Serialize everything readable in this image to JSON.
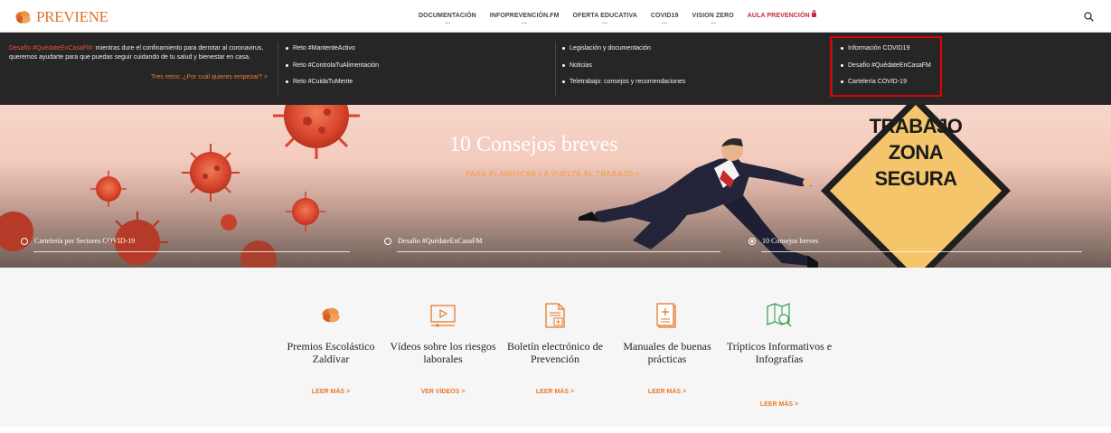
{
  "header": {
    "logo_text": "PREVIENE",
    "nav": [
      {
        "label": "DOCUMENTACIÓN"
      },
      {
        "label": "INFOPREVENCIÓN.FM"
      },
      {
        "label": "OFERTA EDUCATIVA"
      },
      {
        "label": "COVID19"
      },
      {
        "label": "VISION ZERO"
      },
      {
        "label": "AULA PREVENCIÓN"
      }
    ]
  },
  "mega_menu": {
    "intro_highlight": "Desafío #QuédateEnCasaFM:",
    "intro_text": " mientras dure el confinamiento para derrotar al coronavirus, queremos ayudarte para que puedas seguir cuidando de tu salud y bienestar en casa.",
    "cta": "Tres retos: ¿Por cuál quieres empezar? >",
    "col1": [
      "Reto #MantenteActivo",
      "Reto #ControlaTuAlimentación",
      "Reto #CuidaTuMente"
    ],
    "col2": [
      "Legislación y documentación",
      "Noticias",
      "Teletrabajo: consejos y recomendaciones"
    ],
    "col3": [
      "Información COVID19",
      "Desafío #QuédateEnCasaFM",
      "Cartelería COVID-19"
    ]
  },
  "hero": {
    "title": "10 Consejos breves",
    "subtitle": "PARA PLANIFICAR LA VUELTA AL TRABAJO >",
    "sign_lines": [
      "TRABAJO",
      "ZONA",
      "SEGURA"
    ],
    "tabs": [
      "Cartelería por Sectores COVID-19",
      "Desafío #QuédateEnCasaFM",
      "10 Consejos breves"
    ]
  },
  "cards": [
    {
      "title": "Premios Escolástico Zaldívar",
      "link": "LEER MÁS >",
      "icon": "flower-logo-icon"
    },
    {
      "title": "Vídeos sobre los riesgos laborales",
      "link": "VER VÍDEOS >",
      "icon": "video-icon"
    },
    {
      "title": "Boletín electrónico de Prevención",
      "link": "LEER MÁS >",
      "icon": "document-plus-icon"
    },
    {
      "title": "Manuales de buenas prácticas",
      "link": "LEER MÁS >",
      "icon": "manual-plus-icon"
    },
    {
      "title": "Trípticos Informativos e Infografías",
      "link": "LEER MÁS >",
      "icon": "map-search-icon"
    }
  ],
  "colors": {
    "accent": "#e67a2b",
    "dark_menu": "#262626",
    "alert_red": "#c6283e",
    "highlight_box": "#e00000"
  }
}
